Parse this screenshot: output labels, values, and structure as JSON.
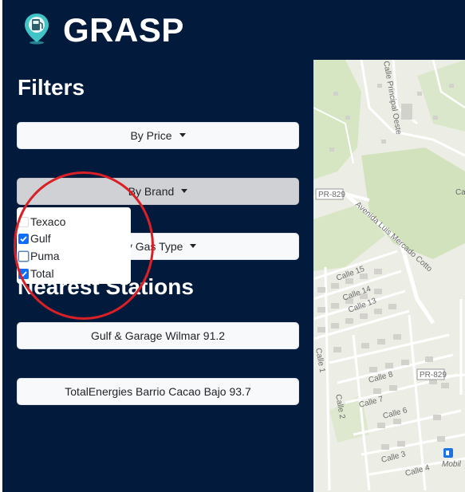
{
  "app": {
    "title": "GRASP",
    "logo_icon": "gas-station-pin-icon"
  },
  "filters": {
    "title": "Filters",
    "by_price_label": "By Price",
    "by_brand_label": "By Brand",
    "by_gas_type_label": "By Gas Type",
    "brand_options": [
      {
        "label": "Texaco",
        "checked": false
      },
      {
        "label": "Gulf",
        "checked": true
      },
      {
        "label": "Puma",
        "checked": false
      },
      {
        "label": "Total",
        "checked": true
      }
    ]
  },
  "nearest": {
    "title": "Nearest Stations",
    "stations": [
      {
        "label": "Gulf & Garage Wilmar 91.2"
      },
      {
        "label": "TotalEnergies Barrio Cacao Bajo 93.7"
      }
    ]
  },
  "map": {
    "labels": {
      "calle_principal": "Calle Principal Oeste",
      "pr829_a": "PR-829",
      "pr829_b": "PR-829",
      "avenida": "Avenida Luis Mercado Cotto",
      "calle15": "Calle 15",
      "calle14": "Calle 14",
      "calle13": "Calle 13",
      "calle1": "Calle 1",
      "calle8": "Calle 8",
      "calle7": "Calle 7",
      "calle6": "Calle 6",
      "calle2": "Calle 2",
      "calle3": "Calle 3",
      "calle4": "Calle 4",
      "cal": "Cal",
      "mobil": "Mobil"
    },
    "colors": {
      "green_area": "#d4e3bf",
      "land": "#eceee6",
      "road": "#ffffff",
      "building": "#d5d3cd"
    }
  },
  "annotation": {
    "color": "#d92026"
  },
  "theme": {
    "background": "#021b3c",
    "accent": "#0d6efd"
  }
}
